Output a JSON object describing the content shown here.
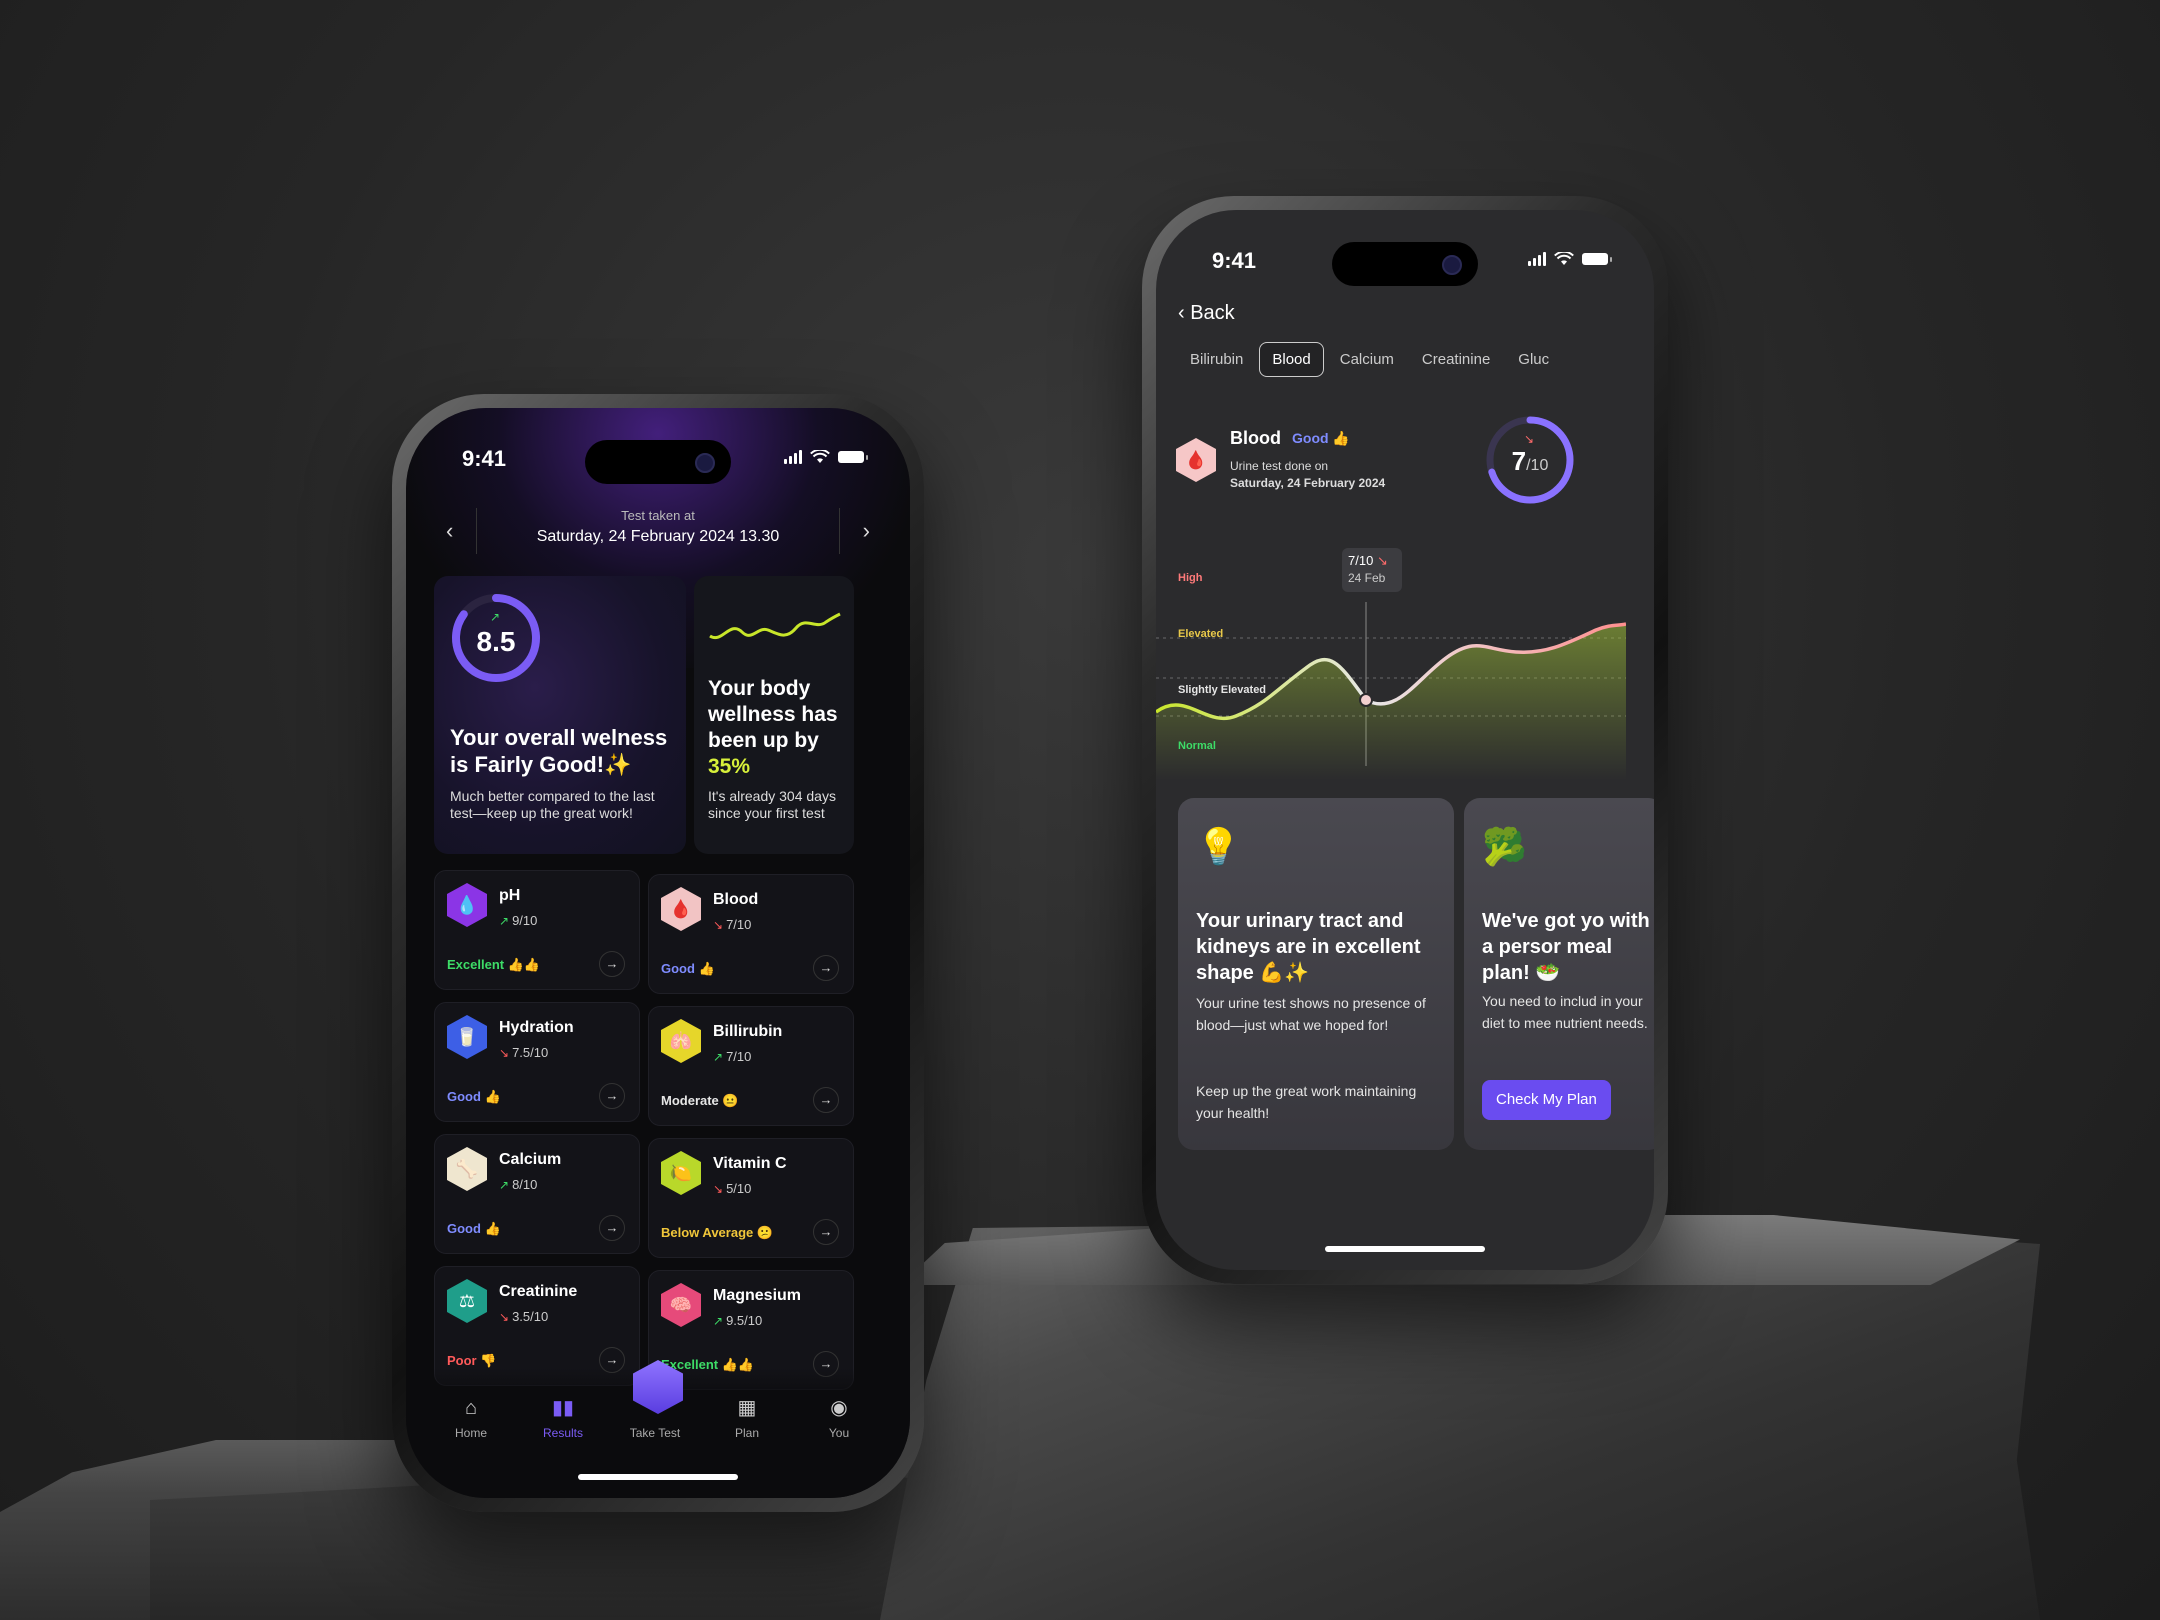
{
  "left_phone": {
    "time": "9:41",
    "test_label": "Test taken at",
    "test_date": "Saturday, 24 February 2024 13.30",
    "overall": {
      "score": "8.5",
      "score_fraction": 0.85,
      "title": "Your overall welness is Fairly Good!✨",
      "desc": "Much better compared to the last test—keep up the great work!"
    },
    "wellness": {
      "title_pre": "Your body wellness has been up by ",
      "percent": "35%",
      "desc": "It's already 304 days since your first test"
    },
    "metrics": [
      {
        "name": "pH",
        "score": "9/10",
        "trend": "up",
        "status": "Excellent 👍👍",
        "status_color": "#3ddc67",
        "hex_color": "#8b35e6",
        "icon": "ph-drop-icon",
        "glyph": "💧"
      },
      {
        "name": "Blood",
        "score": "7/10",
        "trend": "down",
        "status": "Good 👍",
        "status_color": "#7f8cff",
        "hex_color": "#f2c4c4",
        "icon": "blood-drop-icon",
        "glyph": "🩸"
      },
      {
        "name": "Hydration",
        "score": "7.5/10",
        "trend": "down",
        "status": "Good 👍",
        "status_color": "#7f8cff",
        "hex_color": "#3d5fe6",
        "icon": "water-glass-icon",
        "glyph": "🥛"
      },
      {
        "name": "Billirubin",
        "score": "7/10",
        "trend": "up",
        "status": "Moderate 😐",
        "status_color": "#e6e6e6",
        "hex_color": "#e6d62a",
        "icon": "liver-icon",
        "glyph": "🫁"
      },
      {
        "name": "Calcium",
        "score": "8/10",
        "trend": "up",
        "status": "Good 👍",
        "status_color": "#7f8cff",
        "hex_color": "#efe6cf",
        "icon": "bone-icon",
        "glyph": "🦴"
      },
      {
        "name": "Vitamin C",
        "score": "5/10",
        "trend": "down",
        "status": "Below Average 😕",
        "status_color": "#f0c63a",
        "hex_color": "#b9d82a",
        "icon": "citrus-icon",
        "glyph": "🍋"
      },
      {
        "name": "Creatinine",
        "score": "3.5/10",
        "trend": "down",
        "status": "Poor 👎",
        "status_color": "#ff5a5a",
        "hex_color": "#1f9e8a",
        "icon": "scale-icon",
        "glyph": "⚖"
      },
      {
        "name": "Magnesium",
        "score": "9.5/10",
        "trend": "up",
        "status": "Excellent 👍👍",
        "status_color": "#3ddc67",
        "hex_color": "#e64a7a",
        "icon": "brain-icon",
        "glyph": "🧠"
      }
    ],
    "tabs": [
      {
        "label": "Home",
        "icon": "home-icon",
        "glyph": "⌂"
      },
      {
        "label": "Results",
        "icon": "bar-chart-icon",
        "glyph": "▮▮"
      },
      {
        "label": "Take Test",
        "icon": "take-test-hex-icon",
        "glyph": ""
      },
      {
        "label": "Plan",
        "icon": "calendar-icon",
        "glyph": "▦"
      },
      {
        "label": "You",
        "icon": "user-icon",
        "glyph": "◉"
      }
    ]
  },
  "right_phone": {
    "time": "9:41",
    "back_label": "Back",
    "chips": [
      "Bilirubin",
      "Blood",
      "Calcium",
      "Creatinine",
      "Gluc"
    ],
    "active_chip": "Blood",
    "blood": {
      "name": "Blood",
      "status": "Good 👍",
      "sub1": "Urine test done on",
      "sub2": "Saturday, 24 February 2024",
      "score": "7",
      "score_den": "/10",
      "score_fraction": 0.7
    },
    "chart_levels": [
      "High",
      "Elevated",
      "Slightly Elevated",
      "Normal"
    ],
    "level_colors": [
      "#ff7a7a",
      "#e8c84a",
      "#e6e6e6",
      "#3ddc67"
    ],
    "tooltip": {
      "value": "7/10",
      "date": "24 Feb"
    },
    "card_a": {
      "title": "Your urinary tract and kidneys are in excellent shape 💪✨",
      "body": "Your urine test shows no presence of blood—just what we hoped for!",
      "body2": "Keep up the great work maintaining your health!"
    },
    "card_b": {
      "title": "We've got yo with a persor meal plan! 🥗",
      "body": "You need to includ in your diet to mee nutrient needs.",
      "cta": "Check My Plan"
    }
  }
}
